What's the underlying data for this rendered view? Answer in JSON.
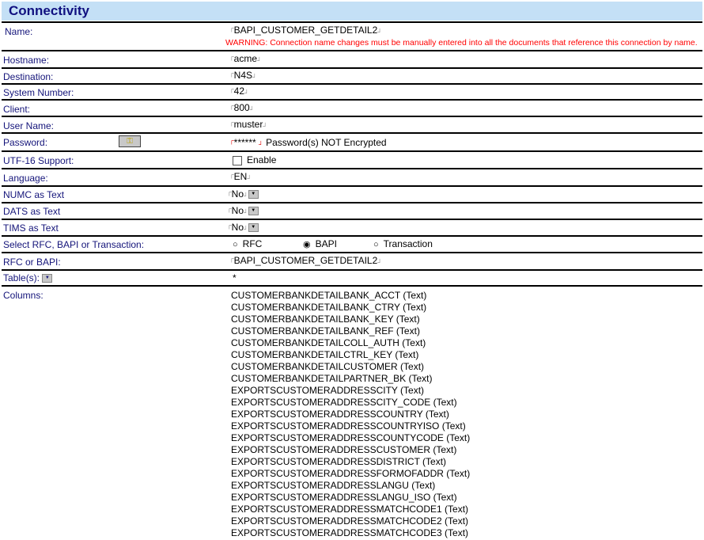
{
  "title": "Connectivity",
  "fields": {
    "name": {
      "label": "Name:",
      "value": "BAPI_CUSTOMER_GETDETAIL2",
      "warning": "WARNING: Connection name changes must be manually entered into all the documents that reference this connection by name."
    },
    "hostname": {
      "label": "Hostname:",
      "value": "acme"
    },
    "destination": {
      "label": "Destination:",
      "value": "N4S"
    },
    "system_number": {
      "label": "System Number:",
      "value": "42"
    },
    "client": {
      "label": "Client:",
      "value": "800"
    },
    "user_name": {
      "label": "User Name:",
      "value": "muster"
    },
    "password": {
      "label": "Password:",
      "value": "******",
      "note": "Password(s) NOT Encrypted"
    },
    "utf16": {
      "label": "UTF-16 Support:",
      "option": "Enable",
      "checked": false
    },
    "language": {
      "label": "Language:",
      "value": "EN"
    },
    "numc": {
      "label": "NUMC as Text",
      "value": "No"
    },
    "dats": {
      "label": "DATS as Text",
      "value": "No"
    },
    "tims": {
      "label": "TIMS as Text",
      "value": "No"
    },
    "select": {
      "label": "Select RFC, BAPI or Transaction:",
      "options": [
        "RFC",
        "BAPI",
        "Transaction"
      ],
      "selected": "BAPI"
    },
    "rfc_bapi": {
      "label": "RFC or BAPI:",
      "value": "BAPI_CUSTOMER_GETDETAIL2"
    },
    "tables": {
      "label": "Table(s):",
      "value": "*"
    },
    "columns": {
      "label": "Columns:",
      "items": [
        "CUSTOMERBANKDETAILBANK_ACCT (Text)",
        "CUSTOMERBANKDETAILBANK_CTRY (Text)",
        "CUSTOMERBANKDETAILBANK_KEY (Text)",
        "CUSTOMERBANKDETAILBANK_REF (Text)",
        "CUSTOMERBANKDETAILCOLL_AUTH (Text)",
        "CUSTOMERBANKDETAILCTRL_KEY (Text)",
        "CUSTOMERBANKDETAILCUSTOMER (Text)",
        "CUSTOMERBANKDETAILPARTNER_BK (Text)",
        "EXPORTSCUSTOMERADDRESSCITY (Text)",
        "EXPORTSCUSTOMERADDRESSCITY_CODE (Text)",
        "EXPORTSCUSTOMERADDRESSCOUNTRY (Text)",
        "EXPORTSCUSTOMERADDRESSCOUNTRYISO (Text)",
        "EXPORTSCUSTOMERADDRESSCOUNTYCODE (Text)",
        "EXPORTSCUSTOMERADDRESSCUSTOMER (Text)",
        "EXPORTSCUSTOMERADDRESSDISTRICT (Text)",
        "EXPORTSCUSTOMERADDRESSFORMOFADDR (Text)",
        "EXPORTSCUSTOMERADDRESSLANGU (Text)",
        "EXPORTSCUSTOMERADDRESSLANGU_ISO (Text)",
        "EXPORTSCUSTOMERADDRESSMATCHCODE1 (Text)",
        "EXPORTSCUSTOMERADDRESSMATCHCODE2 (Text)",
        "EXPORTSCUSTOMERADDRESSMATCHCODE3 (Text)"
      ]
    }
  }
}
